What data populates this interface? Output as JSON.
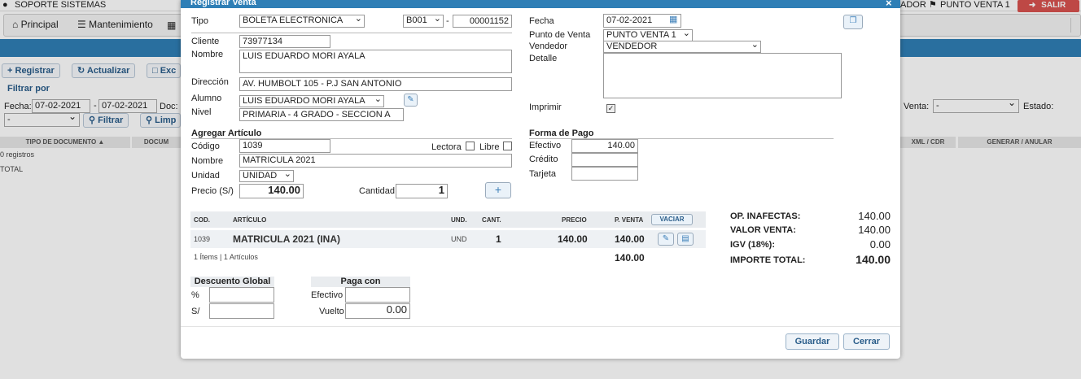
{
  "app": {
    "user": "SOPORTE SISTEMAS",
    "right_user_fragment": "ADOR",
    "point_of_sale": "PUNTO VENTA 1",
    "logout_label": "SALIR",
    "menu": [
      {
        "icon": "home-icon",
        "label": "Principal"
      },
      {
        "icon": "list-icon",
        "label": "Mantenimiento"
      }
    ],
    "toolbar": {
      "register": "Registrar",
      "refresh": "Actualizar",
      "export_fragment": "Exc"
    },
    "filter": {
      "title": "Filtrar por",
      "date_label": "Fecha:",
      "date_from": "07-02-2021",
      "date_sep": "-",
      "date_to": "07-02-2021",
      "doc_label": "Doc:",
      "doc_select": "-",
      "filter_button": "Filtrar",
      "clear_fragment": "Limp",
      "sale_label": "Venta:",
      "sale_select": "-",
      "state_label": "Estado:"
    },
    "table": {
      "headers": [
        "TIPO DE DOCUMENTO",
        "DOCUM",
        "XML / CDR",
        "GENERAR / ANULAR"
      ],
      "records": "0 registros",
      "total": "TOTAL"
    }
  },
  "modal": {
    "title": "Registrar Venta",
    "close": "×",
    "tipo_label": "Tipo",
    "tipo_value": "BOLETA ELECTRONICA",
    "serie_value": "B001",
    "serie_sep": "-",
    "numero_value": "00001152",
    "cliente_label": "Cliente",
    "cliente_value": "73977134",
    "nombre_label": "Nombre",
    "nombre_value": "LUIS EDUARDO MORI AYALA",
    "direccion_label": "Dirección",
    "direccion_value": "AV. HUMBOLT 105 - P.J SAN ANTONIO",
    "alumno_label": "Alumno",
    "alumno_value": "LUIS EDUARDO MORI AYALA",
    "nivel_label": "Nivel",
    "nivel_value": "PRIMARIA - 4 GRADO - SECCION A",
    "fecha_label": "Fecha",
    "fecha_value": "07-02-2021",
    "pv_label": "Punto de Venta",
    "pv_value": "PUNTO VENTA 1",
    "vendedor_label": "Vendedor",
    "vendedor_value": "VENDEDOR",
    "detalle_label": "Detalle",
    "detalle_value": "",
    "imprimir_label": "Imprimir",
    "agregar": {
      "title": "Agregar Artículo",
      "codigo_label": "Código",
      "codigo_value": "1039",
      "lectora_label": "Lectora",
      "libre_label": "Libre",
      "nombre_label": "Nombre",
      "nombre_value": "MATRICULA 2021",
      "unidad_label": "Unidad",
      "unidad_value": "UNIDAD",
      "precio_label": "Precio (S/)",
      "precio_value": "140.00",
      "cantidad_label": "Cantidad",
      "cantidad_value": "1",
      "add_button": "+"
    },
    "pago": {
      "title": "Forma de Pago",
      "efectivo_label": "Efectivo",
      "efectivo_value": "140.00",
      "credito_label": "Crédito",
      "credito_value": "",
      "tarjeta_label": "Tarjeta",
      "tarjeta_value": ""
    },
    "items": {
      "headers": {
        "cod": "COD.",
        "articulo": "ARTÍCULO",
        "und": "UND.",
        "cant": "CANT.",
        "precio": "PRECIO",
        "pventa": "P. VENTA"
      },
      "clear_button": "VACIAR",
      "rows": [
        {
          "cod": "1039",
          "articulo": "MATRICULA 2021 (INA)",
          "und": "UND",
          "cant": "1",
          "precio": "140.00",
          "pventa": "140.00"
        }
      ],
      "summary": "1 Ítems | 1 Artículos",
      "summary_total": "140.00"
    },
    "totals": {
      "op_inafectas_label": "OP. INAFECTAS:",
      "op_inafectas": "140.00",
      "valor_venta_label": "VALOR VENTA:",
      "valor_venta": "140.00",
      "igv_label": "IGV (18%):",
      "igv": "0.00",
      "importe_total_label": "IMPORTE TOTAL:",
      "importe_total": "140.00"
    },
    "descuento": {
      "title": "Descuento Global",
      "pct_label": "%",
      "pct_value": "",
      "soles_label": "S/",
      "soles_value": ""
    },
    "paga_con": {
      "title": "Paga con",
      "efectivo_label": "Efectivo",
      "efectivo_value": "",
      "vuelto_label": "Vuelto",
      "vuelto_value": "0.00"
    },
    "save_button": "Guardar",
    "close_button": "Cerrar"
  },
  "colors": {
    "primary": "#2f7fb6",
    "danger": "#d9534f"
  }
}
